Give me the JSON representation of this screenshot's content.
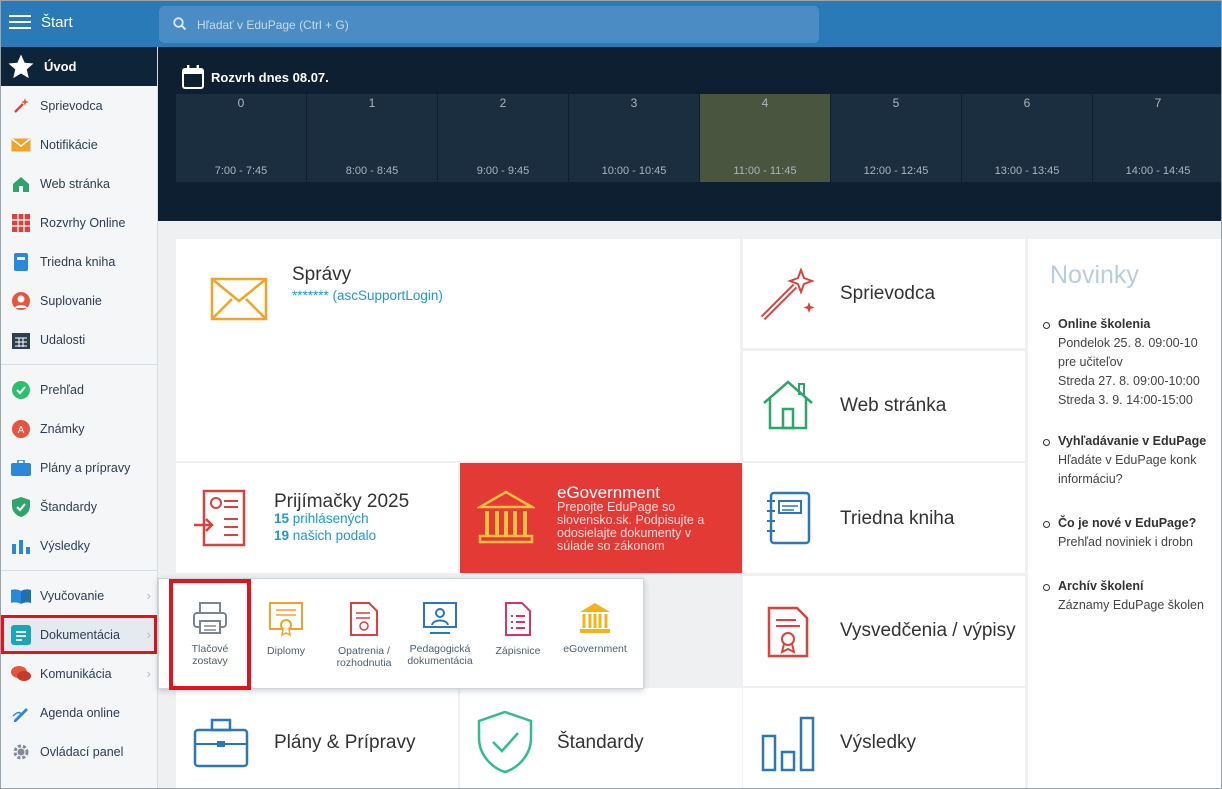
{
  "topbar": {
    "title": "Štart",
    "search_placeholder": "Hľadať v EduPage (Ctrl + G)"
  },
  "sidebar": {
    "home": "Úvod",
    "items": [
      {
        "label": "Sprievodca",
        "icon": "magic-wand-icon"
      },
      {
        "label": "Notifikácie",
        "icon": "envelope-icon"
      },
      {
        "label": "Web stránka",
        "icon": "house-icon"
      },
      {
        "label": "Rozvrhy Online",
        "icon": "timetable-grid-icon"
      },
      {
        "label": "Triedna kniha",
        "icon": "book-icon"
      },
      {
        "label": "Suplovanie",
        "icon": "person-icon"
      },
      {
        "label": "Udalosti",
        "icon": "calendar-icon"
      },
      {
        "label": "Prehľad",
        "icon": "check-circle-icon"
      },
      {
        "label": "Známky",
        "icon": "grade-icon"
      },
      {
        "label": "Plány a prípravy",
        "icon": "briefcase-icon"
      },
      {
        "label": "Štandardy",
        "icon": "shield-check-icon"
      },
      {
        "label": "Výsledky",
        "icon": "bar-chart-icon"
      },
      {
        "label": "Vyučovanie",
        "icon": "open-book-icon"
      },
      {
        "label": "Dokumentácia",
        "icon": "document-icon"
      },
      {
        "label": "Komunikácia",
        "icon": "chat-bubbles-icon"
      },
      {
        "label": "Agenda online",
        "icon": "pen-icon"
      },
      {
        "label": "Ovládací panel",
        "icon": "gear-icon"
      }
    ]
  },
  "timetable": {
    "title": "Rozvrh dnes 08.07.",
    "periods": [
      {
        "num": "0",
        "time": "7:00 - 7:45"
      },
      {
        "num": "1",
        "time": "8:00 - 8:45"
      },
      {
        "num": "2",
        "time": "9:00 - 9:45"
      },
      {
        "num": "3",
        "time": "10:00 - 10:45"
      },
      {
        "num": "4",
        "time": "11:00 - 11:45"
      },
      {
        "num": "5",
        "time": "12:00 - 12:45"
      },
      {
        "num": "6",
        "time": "13:00 - 13:45"
      },
      {
        "num": "7",
        "time": "14:00 - 14:45"
      }
    ],
    "current_period": "4"
  },
  "tiles": {
    "spravy": {
      "label": "Správy",
      "sub": "******* (ascSupportLogin)"
    },
    "sprievodca": {
      "label": "Sprievodca"
    },
    "web": {
      "label": "Web stránka"
    },
    "prijimacky": {
      "label": "Prijímačky 2025",
      "count1": "15",
      "sub1": "prihlásených",
      "count2": "19",
      "sub2": "našich podalo"
    },
    "egov": {
      "label": "eGovernment",
      "desc": "Prepojte EduPage so slovensko.sk. Podpisujte a odosielajte dokumenty v súlade so zákonom"
    },
    "triedna": {
      "label": "Triedna kniha"
    },
    "vysvedcenia": {
      "label": "Vysvedčenia / výpisy"
    },
    "plany": {
      "label": "Plány & Prípravy"
    },
    "standardy": {
      "label": "Štandardy"
    },
    "vysledky": {
      "label": "Výsledky"
    }
  },
  "news": {
    "title": "Novinky",
    "items": [
      {
        "head": "Online školenia",
        "lines": [
          "Pondelok 25. 8. 09:00-10",
          "pre učiteľov",
          "Streda 27. 8. 09:00-10:00",
          "Streda 3. 9. 14:00-15:00"
        ]
      },
      {
        "head": "Vyhľadávanie v EduPage",
        "lines": [
          "Hľadáte v EduPage konk",
          "informáciu?"
        ]
      },
      {
        "head": "Čo je nové v EduPage?",
        "lines": [
          "Prehľad noviniek i drobn"
        ]
      },
      {
        "head": "Archív školení",
        "lines": [
          "Záznamy EduPage školen"
        ]
      }
    ]
  },
  "popup": {
    "items": [
      {
        "label1": "Tlačové",
        "label2": "zostavy",
        "icon": "printer-icon"
      },
      {
        "label1": "Diplomy",
        "label2": "",
        "icon": "diploma-icon"
      },
      {
        "label1": "Opatrenia /",
        "label2": "rozhodnutia",
        "icon": "decision-document-icon"
      },
      {
        "label1": "Pedagogická",
        "label2": "dokumentácia",
        "icon": "teacher-board-icon"
      },
      {
        "label1": "Zápisnice",
        "label2": "",
        "icon": "list-document-icon"
      },
      {
        "label1": "eGovernment",
        "label2": "",
        "icon": "government-building-icon"
      }
    ]
  },
  "colors": {
    "topbar": "#2b7ab8",
    "sidebar_dark": "#0e2439",
    "egov_tile": "#e43a36",
    "highlight": "#e0141c",
    "link": "#1b9ad6"
  }
}
